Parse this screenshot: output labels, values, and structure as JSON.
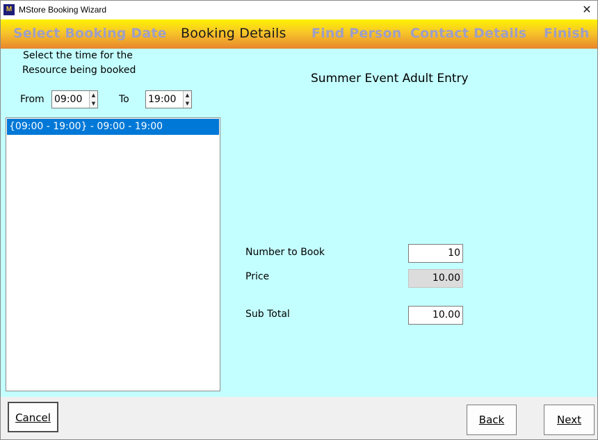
{
  "window": {
    "title": "MStore Booking Wizard",
    "icon_letters": "M",
    "close_glyph": "✕"
  },
  "steps": [
    {
      "label": "Select Booking Date",
      "active": false
    },
    {
      "label": "Booking Details",
      "active": true
    },
    {
      "label": "Find Person",
      "active": false
    },
    {
      "label": "Contact Details",
      "active": false
    },
    {
      "label": "Finish",
      "active": false
    }
  ],
  "instructions": {
    "line1": "Select the time for the",
    "line2": "Resource being booked"
  },
  "time": {
    "from_label": "From",
    "from_value": "09:00",
    "to_label": "To",
    "to_value": "19:00"
  },
  "slots": [
    {
      "text": "{09:00 - 19:00} - 09:00 - 19:00",
      "selected": true
    }
  ],
  "resource_title": "Summer Event Adult Entry",
  "form": {
    "number_label": "Number to Book",
    "number_value": "10",
    "price_label": "Price",
    "price_value": "10.00",
    "subtotal_label": "Sub Total",
    "subtotal_value": "10.00"
  },
  "buttons": {
    "cancel": "Cancel",
    "back": "Back",
    "next": "Next"
  },
  "colors": {
    "content_bg": "#c4ffff",
    "selection": "#0078d7",
    "inactive_step": "#9e9ec6"
  }
}
